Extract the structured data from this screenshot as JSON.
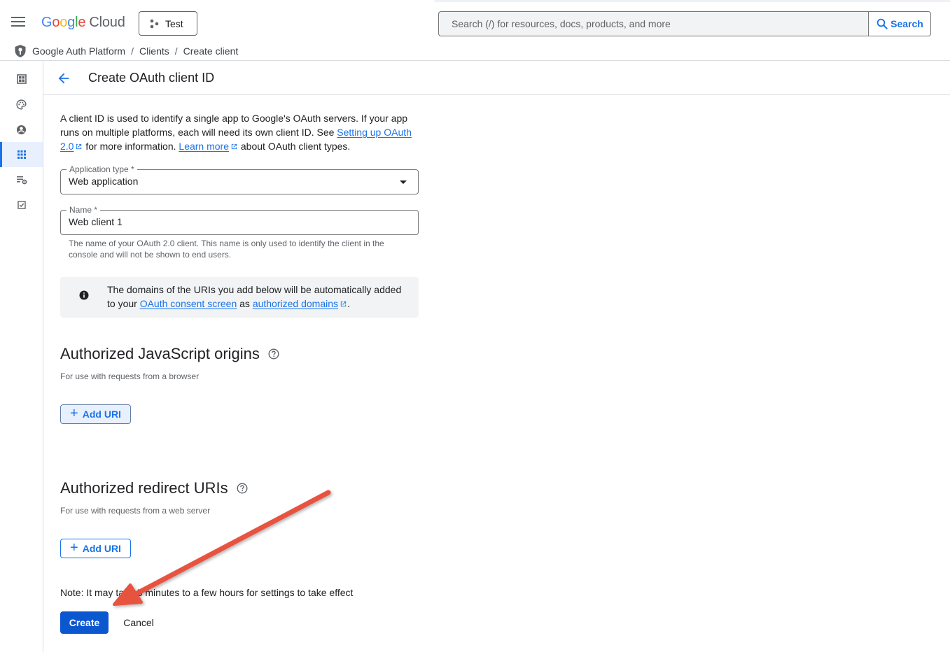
{
  "header": {
    "logo_letters": [
      "G",
      "o",
      "o",
      "g",
      "l",
      "e"
    ],
    "logo_product": "Cloud",
    "project_name": "Test",
    "search_placeholder": "Search (/) for resources, docs, products, and more",
    "search_button": "Search"
  },
  "breadcrumb": {
    "items": [
      "Google Auth Platform",
      "Clients",
      "Create client"
    ],
    "separator": "/"
  },
  "rail": {
    "icons": [
      "dashboard-icon",
      "palette-icon",
      "account-circle-icon",
      "apps-grid-icon",
      "list-settings-icon",
      "checkbox-icon"
    ],
    "active_index": 3
  },
  "page": {
    "title": "Create OAuth client ID"
  },
  "intro": {
    "text_1": "A client ID is used to identify a single app to Google's OAuth servers. If your app runs on multiple platforms, each will need its own client ID. See ",
    "link_1": "Setting up OAuth 2.0",
    "text_2": " for more information. ",
    "link_2": "Learn more",
    "text_3": " about OAuth client types."
  },
  "form": {
    "app_type_label": "Application type *",
    "app_type_value": "Web application",
    "name_label": "Name *",
    "name_value": "Web client 1",
    "name_helper": "The name of your OAuth 2.0 client. This name is only used to identify the client in the console and will not be shown to end users."
  },
  "info": {
    "text_1": "The domains of the URIs you add below will be automatically added to your ",
    "link_1": "OAuth consent screen",
    "text_2": " as ",
    "link_2": "authorized domains",
    "text_3": "."
  },
  "js_origins": {
    "title": "Authorized JavaScript origins",
    "subtitle": "For use with requests from a browser",
    "add_label": "Add URI"
  },
  "redirect_uris": {
    "title": "Authorized redirect URIs",
    "subtitle": "For use with requests from a web server",
    "add_label": "Add URI"
  },
  "footer": {
    "note": "Note: It may take 5 minutes to a few hours for settings to take effect",
    "create_label": "Create",
    "cancel_label": "Cancel"
  },
  "colors": {
    "primary": "#1a73e8",
    "create_button": "#0b57d0",
    "annotation_arrow": "#e8523f"
  }
}
